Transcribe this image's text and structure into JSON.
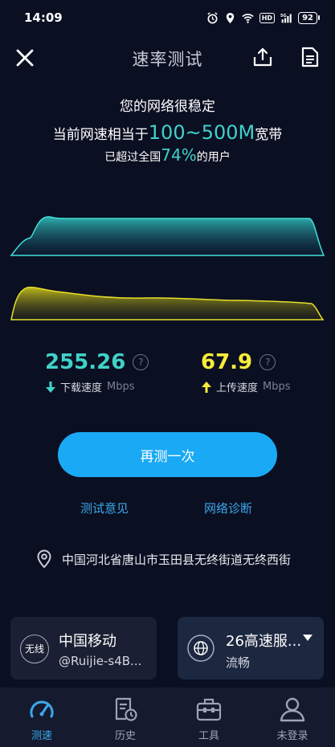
{
  "status_bar": {
    "time": "14:09",
    "network": "5G",
    "battery": "92"
  },
  "header": {
    "title": "速率测试"
  },
  "summary": {
    "line1": "您的网络很稳定",
    "line2_prefix": "当前网速相当于",
    "line2_range": "100~500M",
    "line2_suffix": "宽带",
    "line3_prefix": "已超过全国",
    "line3_percent": "74%",
    "line3_suffix": "的用户"
  },
  "download": {
    "value": "255.26",
    "label": "下载速度",
    "unit": "Mbps",
    "color": "#40d2c9"
  },
  "upload": {
    "value": "67.9",
    "label": "上传速度",
    "unit": "Mbps",
    "color": "#f7ec3a"
  },
  "actions": {
    "retest": "再测一次",
    "feedback": "测试意见",
    "diagnose": "网络诊断"
  },
  "location": "中国河北省唐山市玉田县无终街道无终西街",
  "carrier_card": {
    "badge": "无线",
    "name": "中国移动",
    "ssid": "@Ruijie-s4B..."
  },
  "server_card": {
    "name": "26高速服...",
    "status": "流畅"
  },
  "tabs": [
    {
      "label": "测速",
      "icon": "speedometer-icon",
      "active": true
    },
    {
      "label": "历史",
      "icon": "history-icon",
      "active": false
    },
    {
      "label": "工具",
      "icon": "toolbox-icon",
      "active": false
    },
    {
      "label": "未登录",
      "icon": "user-icon",
      "active": false
    }
  ],
  "colors": {
    "background": "#0b0f22",
    "accent": "#1aa9f4",
    "download": "#40d2c9",
    "upload": "#f7ec3a"
  }
}
